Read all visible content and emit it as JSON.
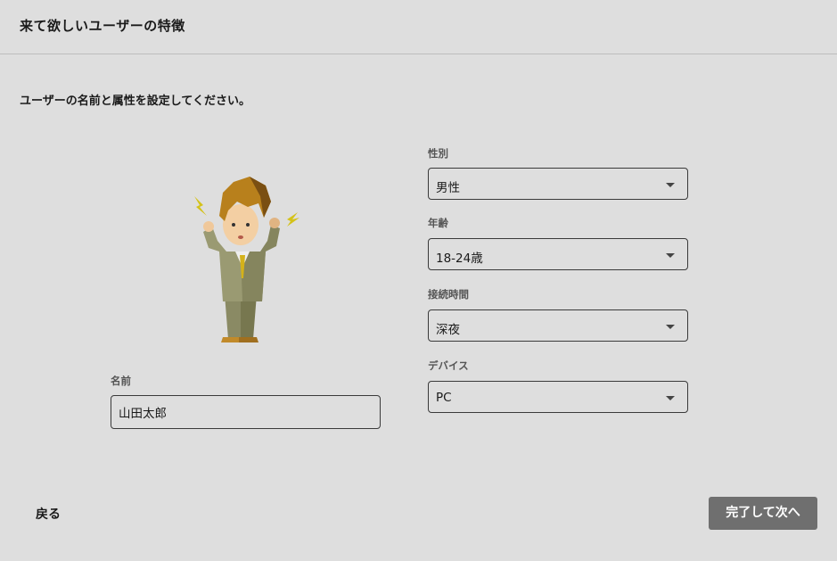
{
  "header": {
    "title": "来て欲しいユーザーの特徴"
  },
  "instruction": "ユーザーの名前と属性を設定してください。",
  "illustration": {
    "icon": "confused-businessman-icon"
  },
  "name_field": {
    "label": "名前",
    "value": "山田太郎"
  },
  "fields": {
    "gender": {
      "label": "性別",
      "value": "男性"
    },
    "age": {
      "label": "年齢",
      "value": "18-24歳"
    },
    "access_time": {
      "label": "接続時間",
      "value": "深夜"
    },
    "device": {
      "label": "デバイス",
      "value": "PC"
    }
  },
  "footer": {
    "back_label": "戻る",
    "next_label": "完了して次へ"
  },
  "colors": {
    "background": "#dedede",
    "primary_button": "#6f6f6f",
    "border": "#3a3a3a"
  }
}
